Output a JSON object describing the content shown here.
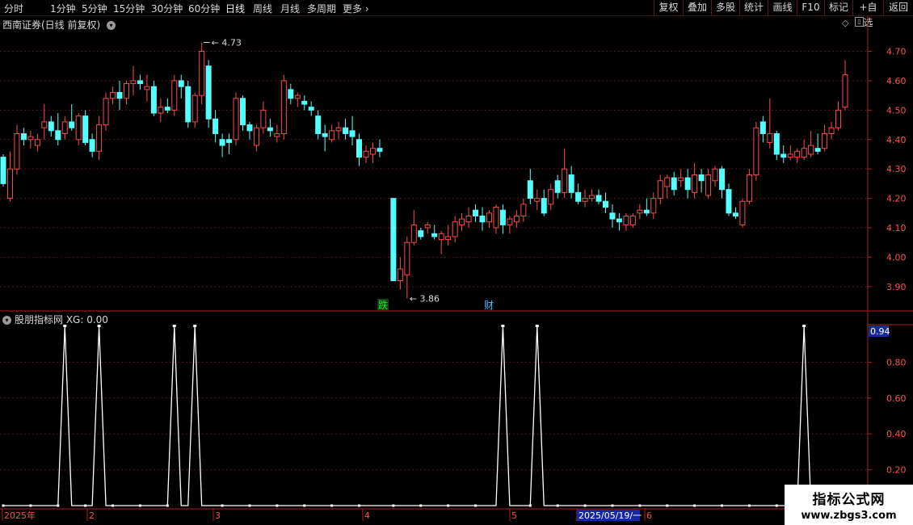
{
  "toolbar": {
    "periods": [
      "分时",
      "1分钟",
      "5分钟",
      "15分钟",
      "30分钟",
      "60分钟",
      "日线",
      "周线",
      "月线",
      "多周期",
      "更多"
    ],
    "active_period": "日线",
    "right_buttons": [
      "复权",
      "叠加",
      "多股",
      "统计",
      "画线",
      "F10",
      "标记",
      "+自选",
      "返回"
    ]
  },
  "main_chart": {
    "title": "西南证券(日线 前复权)",
    "high_label": "4.73",
    "low_label": "3.86",
    "markers": [
      {
        "text": "跌",
        "color": "#00ff00"
      },
      {
        "text": "财",
        "color": "#4fc3ff"
      }
    ]
  },
  "indicator": {
    "title": "股朋指标网 XG: 0.00",
    "current_value": "0.94"
  },
  "date_axis": {
    "labels": [
      "2025年",
      "2",
      "3",
      "4",
      "5",
      "2025/05/19/一",
      "6"
    ]
  },
  "watermark": {
    "line1": "指标公式网",
    "line2": "www.zbgs3.com"
  },
  "colors": {
    "up": "#ff4a4a",
    "down": "#54ffff",
    "grid": "#5a1414",
    "axis": "#b02020"
  },
  "chart_data": [
    {
      "type": "candlestick",
      "title": "西南证券(日线 前复权)",
      "ylim": [
        3.82,
        4.77
      ],
      "yticks": [
        3.9,
        4.0,
        4.1,
        4.2,
        4.3,
        4.4,
        4.5,
        4.6,
        4.7
      ],
      "candles": [
        [
          4.34,
          4.35,
          4.24,
          4.25
        ],
        [
          4.2,
          4.36,
          4.19,
          4.3
        ],
        [
          4.3,
          4.45,
          4.28,
          4.42
        ],
        [
          4.42,
          4.44,
          4.38,
          4.4
        ],
        [
          4.4,
          4.43,
          4.37,
          4.41
        ],
        [
          4.38,
          4.42,
          4.36,
          4.4
        ],
        [
          4.44,
          4.52,
          4.4,
          4.46
        ],
        [
          4.46,
          4.48,
          4.41,
          4.43
        ],
        [
          4.43,
          4.49,
          4.38,
          4.4
        ],
        [
          4.42,
          4.48,
          4.4,
          4.46
        ],
        [
          4.46,
          4.52,
          4.43,
          4.44
        ],
        [
          4.4,
          4.49,
          4.38,
          4.48
        ],
        [
          4.48,
          4.5,
          4.38,
          4.39
        ],
        [
          4.4,
          4.42,
          4.34,
          4.36
        ],
        [
          4.36,
          4.48,
          4.33,
          4.45
        ],
        [
          4.45,
          4.56,
          4.43,
          4.54
        ],
        [
          4.54,
          4.58,
          4.52,
          4.56
        ],
        [
          4.56,
          4.6,
          4.5,
          4.54
        ],
        [
          4.54,
          4.6,
          4.52,
          4.59
        ],
        [
          4.59,
          4.65,
          4.55,
          4.6
        ],
        [
          4.6,
          4.62,
          4.57,
          4.59
        ],
        [
          4.57,
          4.62,
          4.53,
          4.58
        ],
        [
          4.58,
          4.6,
          4.48,
          4.49
        ],
        [
          4.49,
          4.54,
          4.46,
          4.51
        ],
        [
          4.51,
          4.54,
          4.49,
          4.5
        ],
        [
          4.5,
          4.62,
          4.48,
          4.6
        ],
        [
          4.6,
          4.62,
          4.54,
          4.58
        ],
        [
          4.58,
          4.6,
          4.44,
          4.46
        ],
        [
          4.46,
          4.56,
          4.44,
          4.55
        ],
        [
          4.55,
          4.73,
          4.52,
          4.7
        ],
        [
          4.65,
          4.67,
          4.44,
          4.47
        ],
        [
          4.47,
          4.5,
          4.39,
          4.42
        ],
        [
          4.4,
          4.42,
          4.34,
          4.38
        ],
        [
          4.4,
          4.42,
          4.35,
          4.39
        ],
        [
          4.4,
          4.56,
          4.38,
          4.54
        ],
        [
          4.54,
          4.55,
          4.43,
          4.45
        ],
        [
          4.45,
          4.46,
          4.4,
          4.43
        ],
        [
          4.38,
          4.45,
          4.36,
          4.44
        ],
        [
          4.44,
          4.53,
          4.42,
          4.5
        ],
        [
          4.44,
          4.47,
          4.41,
          4.43
        ],
        [
          4.41,
          4.45,
          4.39,
          4.42
        ],
        [
          4.42,
          4.62,
          4.4,
          4.6
        ],
        [
          4.57,
          4.59,
          4.52,
          4.54
        ],
        [
          4.54,
          4.56,
          4.51,
          4.55
        ],
        [
          4.53,
          4.55,
          4.5,
          4.52
        ],
        [
          4.51,
          4.53,
          4.48,
          4.5
        ],
        [
          4.48,
          4.5,
          4.4,
          4.42
        ],
        [
          4.42,
          4.45,
          4.36,
          4.41
        ],
        [
          4.4,
          4.45,
          4.39,
          4.43
        ],
        [
          4.43,
          4.46,
          4.4,
          4.44
        ],
        [
          4.44,
          4.47,
          4.4,
          4.42
        ],
        [
          4.43,
          4.48,
          4.38,
          4.41
        ],
        [
          4.4,
          4.42,
          4.31,
          4.34
        ],
        [
          4.34,
          4.38,
          4.32,
          4.36
        ],
        [
          4.35,
          4.39,
          4.32,
          4.37
        ],
        [
          4.37,
          4.4,
          4.34,
          4.36
        ],
        [
          4.2,
          4.2,
          3.92,
          3.92
        ],
        [
          3.92,
          4.0,
          3.89,
          3.96
        ],
        [
          3.94,
          4.07,
          3.86,
          4.05
        ],
        [
          4.05,
          4.16,
          4.04,
          4.11
        ],
        [
          4.09,
          4.1,
          4.06,
          4.07
        ],
        [
          4.1,
          4.12,
          4.08,
          4.11
        ],
        [
          4.08,
          4.11,
          4.06,
          4.07
        ],
        [
          4.06,
          4.09,
          4.01,
          4.08
        ],
        [
          4.06,
          4.11,
          4.04,
          4.07
        ],
        [
          4.07,
          4.14,
          4.05,
          4.12
        ],
        [
          4.11,
          4.15,
          4.09,
          4.13
        ],
        [
          4.12,
          4.17,
          4.1,
          4.14
        ],
        [
          4.16,
          4.18,
          4.12,
          4.14
        ],
        [
          4.14,
          4.17,
          4.09,
          4.12
        ],
        [
          4.12,
          4.16,
          4.1,
          4.15
        ],
        [
          4.1,
          4.18,
          4.08,
          4.17
        ],
        [
          4.16,
          4.18,
          4.08,
          4.11
        ],
        [
          4.11,
          4.14,
          4.08,
          4.13
        ],
        [
          4.12,
          4.16,
          4.1,
          4.14
        ],
        [
          4.14,
          4.2,
          4.12,
          4.18
        ],
        [
          4.26,
          4.3,
          4.18,
          4.2
        ],
        [
          4.19,
          4.23,
          4.16,
          4.2
        ],
        [
          4.2,
          4.23,
          4.14,
          4.15
        ],
        [
          4.18,
          4.25,
          4.16,
          4.23
        ],
        [
          4.26,
          4.28,
          4.2,
          4.22
        ],
        [
          4.22,
          4.37,
          4.2,
          4.3
        ],
        [
          4.28,
          4.31,
          4.2,
          4.22
        ],
        [
          4.22,
          4.25,
          4.18,
          4.19
        ],
        [
          4.19,
          4.23,
          4.17,
          4.2
        ],
        [
          4.2,
          4.23,
          4.19,
          4.21
        ],
        [
          4.21,
          4.23,
          4.18,
          4.19
        ],
        [
          4.19,
          4.22,
          4.15,
          4.17
        ],
        [
          4.15,
          4.18,
          4.1,
          4.13
        ],
        [
          4.13,
          4.15,
          4.09,
          4.12
        ],
        [
          4.11,
          4.15,
          4.09,
          4.14
        ],
        [
          4.11,
          4.15,
          4.1,
          4.14
        ],
        [
          4.15,
          4.18,
          4.13,
          4.16
        ],
        [
          4.16,
          4.2,
          4.14,
          4.15
        ],
        [
          4.15,
          4.22,
          4.13,
          4.2
        ],
        [
          4.2,
          4.28,
          4.18,
          4.26
        ],
        [
          4.24,
          4.28,
          4.2,
          4.27
        ],
        [
          4.27,
          4.29,
          4.21,
          4.23
        ],
        [
          4.26,
          4.3,
          4.24,
          4.27
        ],
        [
          4.27,
          4.3,
          4.2,
          4.23
        ],
        [
          4.22,
          4.32,
          4.2,
          4.28
        ],
        [
          4.28,
          4.3,
          4.22,
          4.26
        ],
        [
          4.21,
          4.3,
          4.2,
          4.28
        ],
        [
          4.26,
          4.31,
          4.24,
          4.3
        ],
        [
          4.3,
          4.31,
          4.2,
          4.23
        ],
        [
          4.23,
          4.25,
          4.14,
          4.15
        ],
        [
          4.15,
          4.17,
          4.13,
          4.14
        ],
        [
          4.11,
          4.2,
          4.1,
          4.19
        ],
        [
          4.19,
          4.3,
          4.18,
          4.28
        ],
        [
          4.28,
          4.46,
          4.26,
          4.44
        ],
        [
          4.46,
          4.48,
          4.39,
          4.42
        ],
        [
          4.39,
          4.54,
          4.37,
          4.42
        ],
        [
          4.42,
          4.43,
          4.33,
          4.35
        ],
        [
          4.35,
          4.38,
          4.32,
          4.34
        ],
        [
          4.34,
          4.38,
          4.33,
          4.35
        ],
        [
          4.34,
          4.37,
          4.32,
          4.36
        ],
        [
          4.34,
          4.4,
          4.33,
          4.37
        ],
        [
          4.35,
          4.43,
          4.34,
          4.38
        ],
        [
          4.37,
          4.42,
          4.35,
          4.36
        ],
        [
          4.37,
          4.45,
          4.36,
          4.42
        ],
        [
          4.42,
          4.46,
          4.4,
          4.44
        ],
        [
          4.44,
          4.53,
          4.43,
          4.5
        ],
        [
          4.51,
          4.67,
          4.5,
          4.62
        ]
      ]
    },
    {
      "type": "line",
      "name": "XG",
      "ylim": [
        0,
        1.0
      ],
      "yticks": [
        0.2,
        0.4,
        0.6,
        0.8
      ],
      "peaks_at_bar_index": [
        9,
        14,
        25,
        28,
        72,
        77,
        116
      ],
      "values_note": "1 at peaks, 0 elsewhere"
    }
  ]
}
